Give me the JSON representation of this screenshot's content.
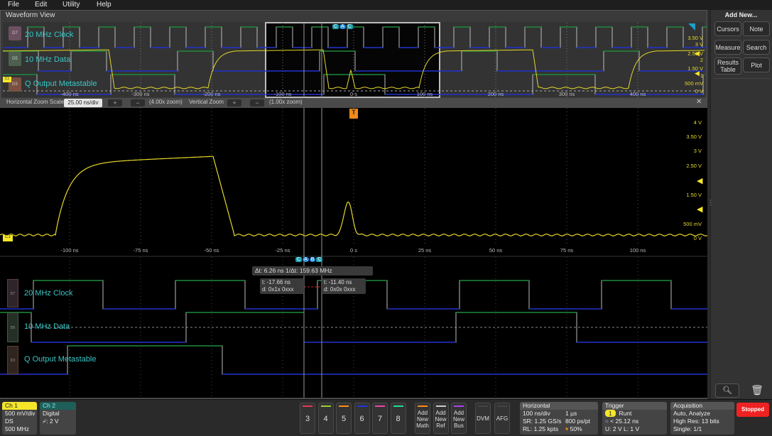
{
  "menu": [
    "File",
    "Edit",
    "Utility",
    "Help"
  ],
  "waveform_view": {
    "title": "Waveform View",
    "signals": [
      {
        "tag": "D7",
        "name": "20 MHz Clock"
      },
      {
        "tag": "D5",
        "name": "10 MHz Data"
      },
      {
        "tag": "D3",
        "name": "Q Output Metastable"
      }
    ],
    "analog_channel_tag": "C1",
    "overview_time_ticks": [
      "-400 ns",
      "-300 ns",
      "-200 ns",
      "-100 ns",
      "0 s",
      "100 ns",
      "200 ns",
      "300 ns",
      "400 ns"
    ],
    "overview_volt_ticks": [
      "3.50 V",
      "3 V",
      "2.50 V",
      "2",
      "1.50 V",
      "1",
      "500 mV",
      "0 V"
    ],
    "cursor_markers": [
      "C",
      "A",
      "B",
      "C"
    ],
    "trigger_marker": "T",
    "zoom_bar": {
      "h_label": "Horizontal Zoom Scale",
      "h_value": "25.00 ns/div",
      "h_zoom": "(4.00x zoom)",
      "v_label": "Vertical Zoom",
      "v_zoom": "(1.00x zoom)",
      "plus": "+",
      "minus": "−",
      "close": "✕"
    },
    "zoom_time_ticks": [
      "-100 ns",
      "-75 ns",
      "-50 ns",
      "-25 ns",
      "0 s",
      "25 ns",
      "50 ns",
      "75 ns",
      "100 ns"
    ],
    "zoom_volt_ticks": [
      "4 V",
      "3.50 V",
      "3 V",
      "2.50 V",
      "1.50 V",
      "500 mV",
      "0 V"
    ],
    "cursor_readout": {
      "delta": "Δt:  6.26 ns 1/Δt:  159.63 MHz",
      "a_time": "t:  -17.66 ns",
      "a_data": "d:  0x1x 0xxx",
      "b_time": "t:  -11.40 ns",
      "b_data": "d:  0x0x 0xxx"
    }
  },
  "side_panel": {
    "title": "Add New...",
    "buttons": [
      "Cursors",
      "Note",
      "Measure",
      "Search",
      "Results Table",
      "Plot"
    ]
  },
  "bottom": {
    "ch1": {
      "title": "Ch 1",
      "lines": [
        "500 mV/div",
        "DS",
        "500 MHz"
      ],
      "color": "#f5e62a"
    },
    "ch2": {
      "title": "Ch 2",
      "lines": [
        "Digital",
        "⌿: 2 V"
      ],
      "color": "#1f5f5a"
    },
    "channel_buttons": [
      {
        "label": "3",
        "color": "#e8384f"
      },
      {
        "label": "4",
        "color": "#9acd32"
      },
      {
        "label": "5",
        "color": "#ff8c1a"
      },
      {
        "label": "6",
        "color": "#2233dd"
      },
      {
        "label": "7",
        "color": "#ee44aa"
      },
      {
        "label": "8",
        "color": "#22dd99"
      }
    ],
    "add_buttons": [
      {
        "label": "Add New Math",
        "color": "#ff8c1a"
      },
      {
        "label": "Add New Ref",
        "color": "#cccccc"
      },
      {
        "label": "Add New Bus",
        "color": "#aa44ee"
      }
    ],
    "tool_buttons": [
      "DVM",
      "AFG"
    ],
    "horizontal": {
      "title": "Horizontal",
      "lines": [
        [
          "100 ns/div",
          "1 µs"
        ],
        [
          "SR: 1.25 GS/s",
          "800 ps/pt"
        ],
        [
          "RL: 1.25 kpts",
          "50%"
        ]
      ]
    },
    "trigger": {
      "title": "Trigger",
      "source": "1",
      "type": "Runt",
      "lines": [
        "< 25.12 ns",
        "U: 2 V  L: 1 V"
      ]
    },
    "acquisition": {
      "title": "Acquisition",
      "lines": [
        "Auto,    Analyze",
        "High Res: 13 bits",
        "Single: 1/1"
      ]
    },
    "status": "Stopped",
    "status_color": "#ee2222"
  }
}
